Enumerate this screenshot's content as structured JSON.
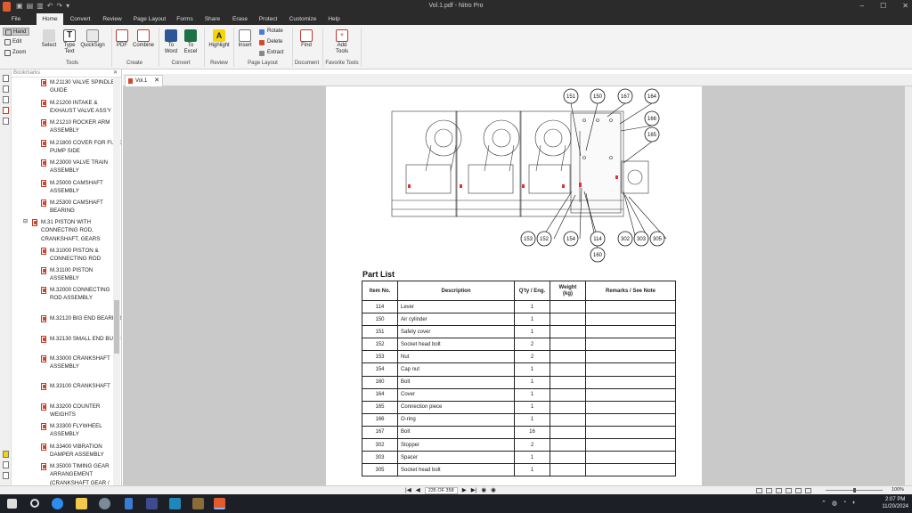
{
  "window": {
    "title": "Vol.1.pdf - Nitro Pro",
    "controls": [
      "–",
      "☐",
      "✕"
    ]
  },
  "menu_tabs": [
    "File",
    "Home",
    "Convert",
    "Review",
    "Page Layout",
    "Forms",
    "Share",
    "Erase",
    "Protect",
    "Customize",
    "Help"
  ],
  "ribbon": {
    "hand": "Hand",
    "edit": "Edit",
    "zoom": "Zoom",
    "select": "Select",
    "type_text": "Type Text",
    "quicksign": "QuickSign",
    "tools_group": "Tools",
    "pdf": "PDF",
    "combine": "Combine",
    "create_group": "Create",
    "to_word": "To Word",
    "to_excel": "To Excel",
    "convert_group": "Convert",
    "highlight": "Highlight",
    "review_group": "Review",
    "insert": "Insert",
    "rotate": "Rotate",
    "delete": "Delete",
    "extract": "Extract",
    "page_layout_group": "Page Layout",
    "find": "Find",
    "document_group": "Document",
    "add_tools": "Add Tools",
    "favorite_group": "Favorite Tools"
  },
  "bookmarks": {
    "header": "Bookmarks",
    "items": [
      {
        "label": "M.21130 VALVE SPINDLE GUIDE"
      },
      {
        "label": "M.21200 INTAKE & EXHAUST VALVE ASS'Y"
      },
      {
        "label": "M.21210 ROCKER ARM ASSEMBLY"
      },
      {
        "label": "M.21800 COVER FOR FULE PUMP SIDE"
      },
      {
        "label": "M.23000 VALVE TRAIN ASSEMBLY"
      },
      {
        "label": "M.25000 CAMSHAFT ASSEMBLY"
      },
      {
        "label": "M.25300 CAMSHAFT BEARING"
      },
      {
        "label": "M.31   PISTON WITH CONNECTING ROD, CRANKSHAFT, GEARS"
      },
      {
        "label": "M.31000 PISTON & CONNECTING ROD"
      },
      {
        "label": "M.31100 PISTON ASSEMBLY"
      },
      {
        "label": "M.32000 CONNECTING ROD ASSEMBLY"
      },
      {
        "label": "M.32120 BIG END BEARING"
      },
      {
        "label": "M.32130 SMALL END BUSH"
      },
      {
        "label": "M.33000 CRANKSHAFT ASSEMBLY"
      },
      {
        "label": "M.33100 CRANKSHAFT"
      },
      {
        "label": "M.33200 COUNTER WEIGHTS"
      },
      {
        "label": "M.33300 FLYWHEEL ASSEMBLY"
      },
      {
        "label": "M.33400 VIBRATION DAMPER ASSEMBLY"
      },
      {
        "label": "M.35000 TIMING GEAR ARRANGEMENT (CRANKSHAFT GEAR /"
      }
    ]
  },
  "doc_tab": {
    "label": "Vol.1"
  },
  "drawing": {
    "callouts_top": [
      "151",
      "150",
      "167",
      "164",
      "166",
      "165"
    ],
    "callouts_bottom": [
      "153",
      "152",
      "154",
      "114",
      "302",
      "303",
      "305",
      "160"
    ]
  },
  "part_list": {
    "title": "Part List",
    "headers": [
      "Item No.",
      "Description",
      "Q'ty / Eng.",
      "Weight\n(kg)",
      "Remarks / See Note"
    ],
    "rows": [
      [
        "114",
        "Lever",
        "1",
        "",
        ""
      ],
      [
        "150",
        "Air cylinder",
        "1",
        "",
        ""
      ],
      [
        "151",
        "Safety cover",
        "1",
        "",
        ""
      ],
      [
        "152",
        "Socket head bolt",
        "2",
        "",
        ""
      ],
      [
        "153",
        "Nut",
        "2",
        "",
        ""
      ],
      [
        "154",
        "Cap nut",
        "1",
        "",
        ""
      ],
      [
        "160",
        "Bolt",
        "1",
        "",
        ""
      ],
      [
        "164",
        "Cover",
        "1",
        "",
        ""
      ],
      [
        "165",
        "Connection piece",
        "1",
        "",
        ""
      ],
      [
        "166",
        "O-ring",
        "1",
        "",
        ""
      ],
      [
        "167",
        "Bolt",
        "16",
        "",
        ""
      ],
      [
        "302",
        "Stopper",
        "2",
        "",
        ""
      ],
      [
        "303",
        "Spacer",
        "1",
        "",
        ""
      ],
      [
        "305",
        "Socket head bolt",
        "1",
        "",
        ""
      ]
    ]
  },
  "status": {
    "page_indicator": "235 OF 358",
    "zoom": "100%"
  },
  "taskbar": {
    "time": "2:07 PM",
    "date": "11/20/2024"
  }
}
